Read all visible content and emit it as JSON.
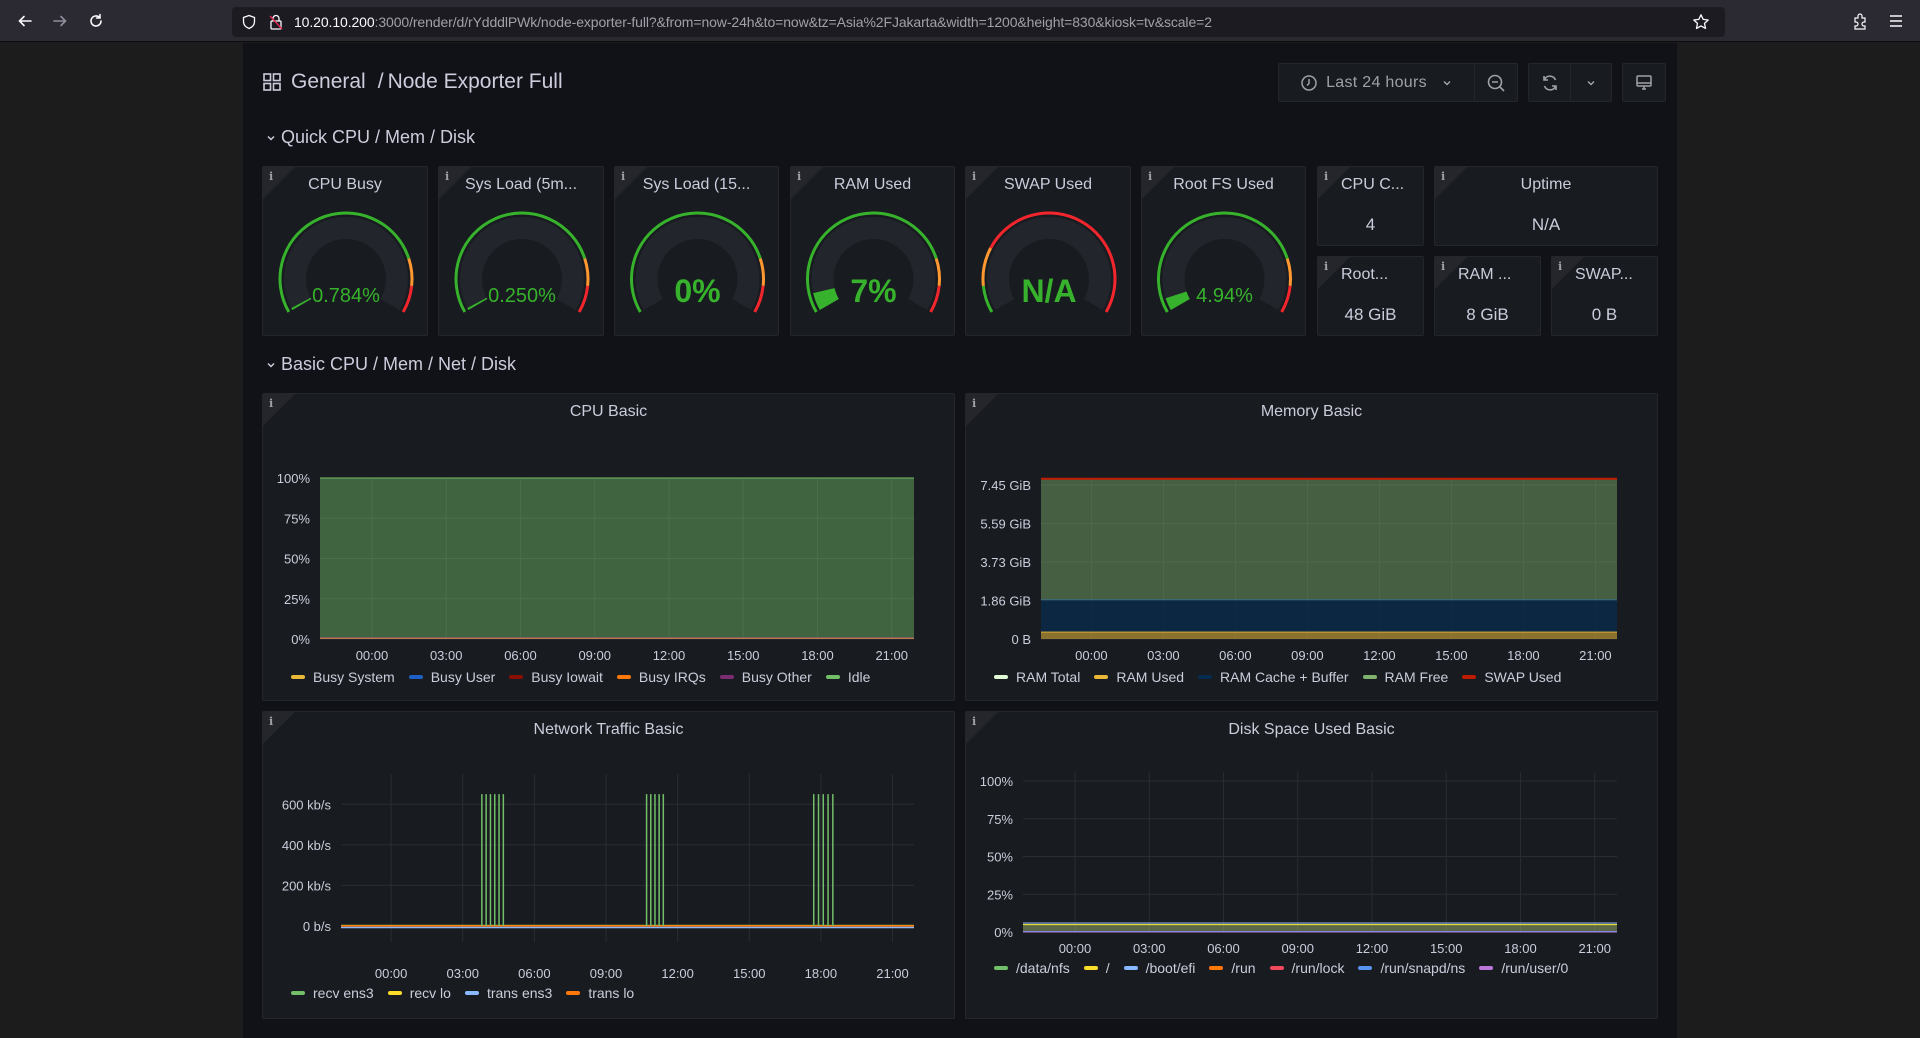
{
  "browser": {
    "url_host": "10.20.10.200",
    "url_rest": ":3000/render/d/rYdddlPWk/node-exporter-full?&from=now-24h&to=now&tz=Asia%2FJakarta&width=1200&height=830&kiosk=tv&scale=2",
    "icons": [
      "back-arrow-icon",
      "forward-arrow-icon",
      "reload-icon",
      "shield-icon",
      "insecure-lock-icon",
      "bookmark-star-icon",
      "extensions-icon",
      "menu-icon"
    ]
  },
  "dashboard": {
    "folder": "General",
    "separator": "/",
    "title": "Node Exporter Full",
    "time_range": "Last 24 hours"
  },
  "rows": [
    {
      "title": "Quick CPU / Mem / Disk"
    },
    {
      "title": "Basic CPU / Mem / Net / Disk"
    }
  ],
  "gauges": [
    {
      "title": "CPU Busy",
      "value_text": "0.784%",
      "value": 0.784,
      "max": 100,
      "value_color": "#37b22c",
      "thresholds": "green-orange-red"
    },
    {
      "title": "Sys Load (5m...",
      "value_text": "0.250%",
      "value": 0.25,
      "max": 100,
      "value_color": "#37b22c",
      "thresholds": "green-orange-red"
    },
    {
      "title": "Sys Load (15...",
      "value_text": "0%",
      "value": 0,
      "max": 100,
      "value_color": "#37b22c",
      "thresholds": "green-orange-red"
    },
    {
      "title": "RAM Used",
      "value_text": "7%",
      "value": 7,
      "max": 100,
      "value_color": "#37b22c",
      "thresholds": "green-orange-red"
    },
    {
      "title": "SWAP Used",
      "value_text": "N/A",
      "value": null,
      "max": 100,
      "value_color": "#37b22c",
      "thresholds": "green-orange-red-swap"
    },
    {
      "title": "Root FS Used",
      "value_text": "4.94%",
      "value": 4.94,
      "max": 100,
      "value_color": "#37b22c",
      "thresholds": "green-orange-red"
    }
  ],
  "stats": [
    {
      "title": "CPU C...",
      "value": "4"
    },
    {
      "title": "Uptime",
      "value": "N/A"
    },
    {
      "title": "Root...",
      "value": "48 GiB"
    },
    {
      "title": "RAM ...",
      "value": "8 GiB"
    },
    {
      "title": "SWAP...",
      "value": "0 B"
    }
  ],
  "chart_data": [
    {
      "type": "area",
      "title": "CPU Basic",
      "x": [
        "00:00",
        "03:00",
        "06:00",
        "09:00",
        "12:00",
        "15:00",
        "18:00",
        "21:00"
      ],
      "yticks": [
        "0%",
        "25%",
        "50%",
        "75%",
        "100%"
      ],
      "ylim": [
        0,
        100
      ],
      "stacked": true,
      "series": [
        {
          "name": "Busy System",
          "color": "#eab839",
          "values": [
            0.3,
            0.3,
            0.3,
            0.3,
            0.3,
            0.3,
            0.3,
            0.3
          ]
        },
        {
          "name": "Busy User",
          "color": "#1f60c4",
          "values": [
            0.4,
            0.4,
            0.4,
            0.4,
            0.4,
            0.4,
            0.4,
            0.4
          ]
        },
        {
          "name": "Busy Iowait",
          "color": "#890f02",
          "values": [
            0.1,
            0.1,
            0.1,
            0.1,
            0.1,
            0.1,
            0.1,
            0.1
          ]
        },
        {
          "name": "Busy IRQs",
          "color": "#ff780a",
          "values": [
            0,
            0,
            0,
            0,
            0,
            0,
            0,
            0
          ]
        },
        {
          "name": "Busy Other",
          "color": "#7b2c73",
          "values": [
            0,
            0,
            0,
            0,
            0,
            0,
            0,
            0
          ]
        },
        {
          "name": "Idle",
          "color": "#73bf69",
          "values": [
            99.2,
            99.2,
            99.2,
            99.2,
            99.2,
            99.2,
            99.2,
            99.2
          ]
        }
      ]
    },
    {
      "type": "area",
      "title": "Memory Basic",
      "x": [
        "00:00",
        "03:00",
        "06:00",
        "09:00",
        "12:00",
        "15:00",
        "18:00",
        "21:00"
      ],
      "yticks": [
        "0 B",
        "1.86 GiB",
        "3.73 GiB",
        "5.59 GiB",
        "7.45 GiB"
      ],
      "ylim": [
        0,
        7.45
      ],
      "unit": "GiB",
      "series": [
        {
          "name": "RAM Total",
          "color": "#e0f9d7",
          "values": [
            7.75,
            7.75,
            7.75,
            7.75,
            7.75,
            7.75,
            7.75,
            7.75
          ]
        },
        {
          "name": "RAM Used",
          "color": "#eab839",
          "values": [
            0.35,
            0.35,
            0.35,
            0.35,
            0.4,
            0.35,
            0.35,
            0.35
          ]
        },
        {
          "name": "RAM Cache + Buffer",
          "color": "#052b51",
          "values": [
            1.55,
            1.55,
            1.55,
            1.55,
            1.55,
            1.55,
            1.55,
            1.55
          ]
        },
        {
          "name": "RAM Free",
          "color": "#7eb26d",
          "values": [
            5.85,
            5.85,
            5.85,
            5.85,
            5.8,
            5.85,
            5.85,
            5.85
          ]
        },
        {
          "name": "SWAP Used",
          "color": "#bf1b00",
          "values": [
            0,
            0,
            0,
            0,
            0,
            0,
            0,
            0
          ]
        }
      ]
    },
    {
      "type": "line",
      "title": "Network Traffic Basic",
      "x": [
        "00:00",
        "03:00",
        "06:00",
        "09:00",
        "12:00",
        "15:00",
        "18:00",
        "21:00"
      ],
      "yticks": [
        "0 b/s",
        "200 kb/s",
        "400 kb/s",
        "600 kb/s"
      ],
      "ylim": [
        -30,
        700
      ],
      "unit": "kb/s",
      "spikes": [
        {
          "start_hour": 3.8,
          "end_hour": 4.7,
          "count": 6,
          "value": 650
        },
        {
          "start_hour": 10.7,
          "end_hour": 11.4,
          "count": 5,
          "value": 650
        },
        {
          "start_hour": 17.7,
          "end_hour": 18.5,
          "count": 5,
          "value": 650
        }
      ],
      "series": [
        {
          "name": "recv ens3",
          "color": "#73bf69",
          "baseline": 2
        },
        {
          "name": "recv lo",
          "color": "#fade2a",
          "baseline": 1
        },
        {
          "name": "trans ens3",
          "color": "#8ab8ff",
          "baseline": -8
        },
        {
          "name": "trans lo",
          "color": "#ff780a",
          "baseline": 0
        }
      ]
    },
    {
      "type": "area",
      "title": "Disk Space Used Basic",
      "x": [
        "00:00",
        "03:00",
        "06:00",
        "09:00",
        "12:00",
        "15:00",
        "18:00",
        "21:00"
      ],
      "yticks": [
        "0%",
        "25%",
        "50%",
        "75%",
        "100%"
      ],
      "ylim": [
        0,
        100
      ],
      "series": [
        {
          "name": "/data/nfs",
          "color": "#73bf69",
          "value": 5
        },
        {
          "name": "/",
          "color": "#fade2a",
          "value": 4.9
        },
        {
          "name": "/boot/efi",
          "color": "#8ab8ff",
          "value": 6
        },
        {
          "name": "/run",
          "color": "#ff780a",
          "value": 0.3
        },
        {
          "name": "/run/lock",
          "color": "#f2495c",
          "value": 0
        },
        {
          "name": "/run/snapd/ns",
          "color": "#5794f2",
          "value": 0.3
        },
        {
          "name": "/run/user/0",
          "color": "#b877d9",
          "value": 0
        }
      ]
    }
  ]
}
